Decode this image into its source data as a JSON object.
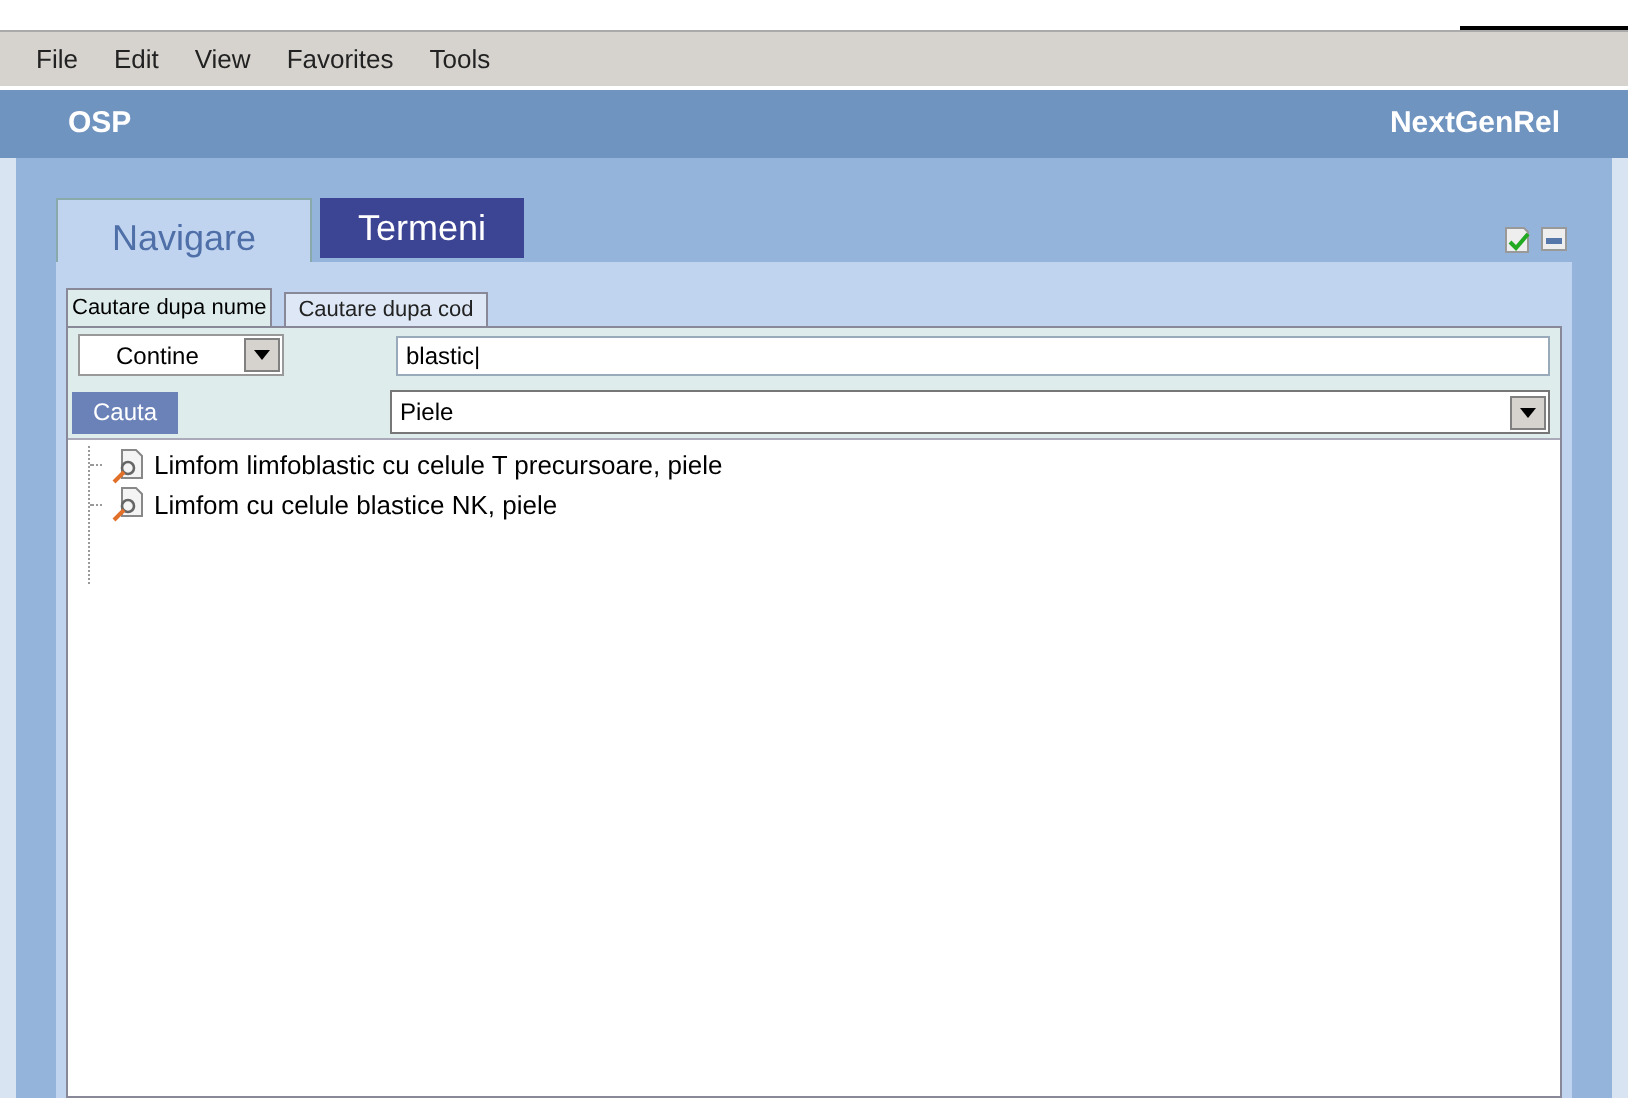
{
  "menu": [
    "File",
    "Edit",
    "View",
    "Favorites",
    "Tools"
  ],
  "header": {
    "title": "OSP",
    "app": "NextGenRel"
  },
  "tabs": [
    {
      "label": "Navigare",
      "selected": true
    },
    {
      "label": "Termeni",
      "selected": false
    }
  ],
  "subtabs": [
    {
      "label": "Cautare dupa nume",
      "selected": true
    },
    {
      "label": "Cautare dupa cod",
      "selected": false
    }
  ],
  "match_select": {
    "value": "Contine"
  },
  "search": {
    "value": "blastic|"
  },
  "search_button": "Cauta",
  "category_select": {
    "value": "Piele"
  },
  "results": [
    {
      "label": "Limfom limfoblastic cu celule T precursoare, piele"
    },
    {
      "label": "Limfom cu celule blastice NK, piele"
    }
  ]
}
